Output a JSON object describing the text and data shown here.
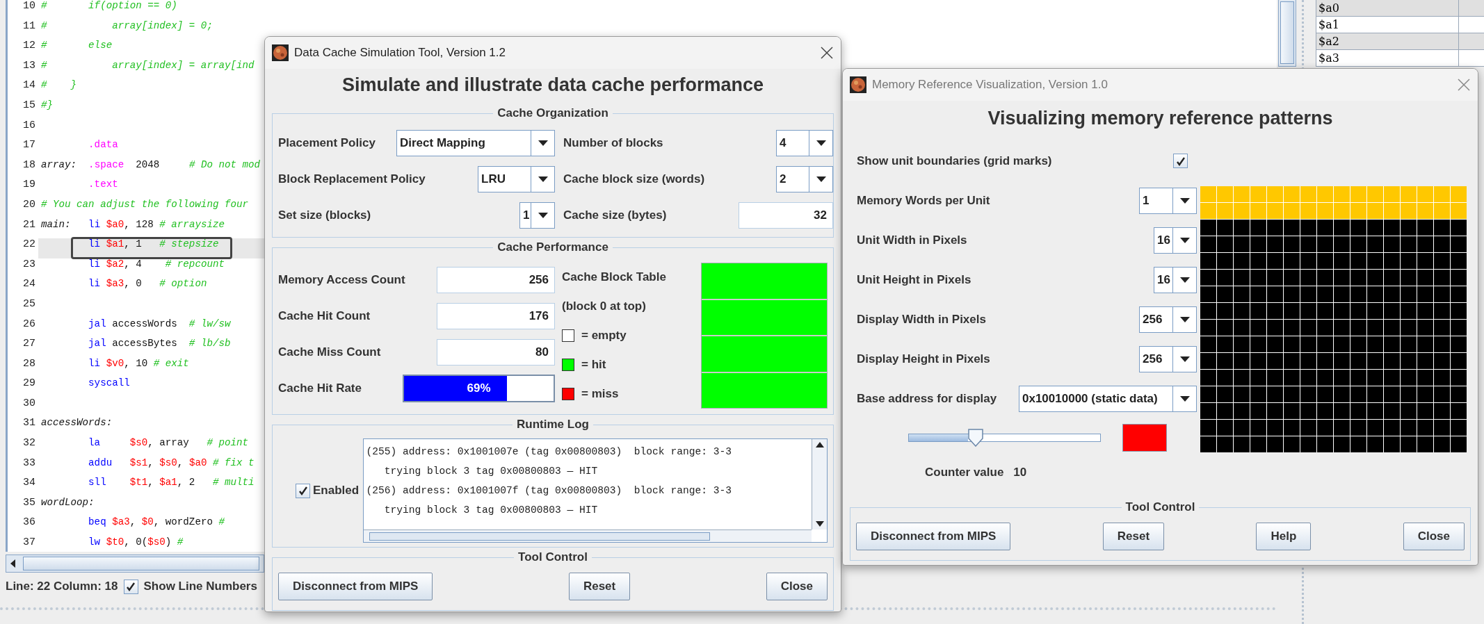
{
  "editor": {
    "lines": [
      {
        "number": "10",
        "current": false,
        "boxed": false,
        "tokens": [
          {
            "kind": "comment",
            "text": "#       if(option == 0)"
          }
        ]
      },
      {
        "number": "11",
        "current": false,
        "boxed": false,
        "tokens": [
          {
            "kind": "comment",
            "text": "#           array[index] = 0;"
          }
        ]
      },
      {
        "number": "12",
        "current": false,
        "boxed": false,
        "tokens": [
          {
            "kind": "comment",
            "text": "#       else"
          }
        ]
      },
      {
        "number": "13",
        "current": false,
        "boxed": false,
        "tokens": [
          {
            "kind": "comment",
            "text": "#           array[index] = array[ind"
          }
        ]
      },
      {
        "number": "14",
        "current": false,
        "boxed": false,
        "tokens": [
          {
            "kind": "comment",
            "text": "#    }"
          }
        ]
      },
      {
        "number": "15",
        "current": false,
        "boxed": false,
        "tokens": [
          {
            "kind": "comment",
            "text": "#}"
          }
        ]
      },
      {
        "number": "16",
        "current": false,
        "boxed": false
      },
      {
        "number": "17",
        "current": false,
        "boxed": false,
        "tokens": [
          {
            "kind": "directive",
            "text": "        .data"
          }
        ]
      },
      {
        "number": "18",
        "current": false,
        "boxed": false,
        "tokens": [
          {
            "kind": "label",
            "text": "array:"
          },
          {
            "kind": "directive",
            "text": "  .space"
          },
          {
            "kind": "text",
            "text": "  2048     "
          },
          {
            "kind": "comment",
            "text": "# Do not mod"
          }
        ]
      },
      {
        "number": "19",
        "current": false,
        "boxed": false,
        "tokens": [
          {
            "kind": "directive",
            "text": "        .text"
          }
        ]
      },
      {
        "number": "20",
        "current": false,
        "boxed": false,
        "tokens": [
          {
            "kind": "comment",
            "text": "# You can adjust the following four"
          }
        ]
      },
      {
        "number": "21",
        "current": false,
        "boxed": false,
        "tokens": [
          {
            "kind": "label",
            "text": "main:"
          },
          {
            "kind": "op",
            "text": "   li"
          },
          {
            "kind": "reg",
            "text": " $a0"
          },
          {
            "kind": "text",
            "text": ", 128 "
          },
          {
            "kind": "comment",
            "text": "# arraysize"
          }
        ]
      },
      {
        "number": "22",
        "current": true,
        "boxed": true,
        "tokens": [
          {
            "kind": "op",
            "text": "        li"
          },
          {
            "kind": "reg",
            "text": " $a1"
          },
          {
            "kind": "text",
            "text": ", 1   "
          },
          {
            "kind": "comment",
            "text": "# stepsize"
          }
        ]
      },
      {
        "number": "23",
        "current": false,
        "boxed": false,
        "tokens": [
          {
            "kind": "op",
            "text": "        li"
          },
          {
            "kind": "reg",
            "text": " $a2"
          },
          {
            "kind": "text",
            "text": ", 4    "
          },
          {
            "kind": "comment",
            "text": "# repcount"
          }
        ]
      },
      {
        "number": "24",
        "current": false,
        "boxed": false,
        "tokens": [
          {
            "kind": "op",
            "text": "        li"
          },
          {
            "kind": "reg",
            "text": " $a3"
          },
          {
            "kind": "text",
            "text": ", 0   "
          },
          {
            "kind": "comment",
            "text": "# option"
          }
        ]
      },
      {
        "number": "25",
        "current": false,
        "boxed": false
      },
      {
        "number": "26",
        "current": false,
        "boxed": false,
        "tokens": [
          {
            "kind": "op",
            "text": "        jal"
          },
          {
            "kind": "text",
            "text": " accessWords  "
          },
          {
            "kind": "comment",
            "text": "# lw/sw"
          }
        ]
      },
      {
        "number": "27",
        "current": false,
        "boxed": false,
        "tokens": [
          {
            "kind": "op",
            "text": "        jal"
          },
          {
            "kind": "text",
            "text": " accessBytes  "
          },
          {
            "kind": "comment",
            "text": "# lb/sb"
          }
        ]
      },
      {
        "number": "28",
        "current": false,
        "boxed": false,
        "tokens": [
          {
            "kind": "op",
            "text": "        li"
          },
          {
            "kind": "reg",
            "text": " $v0"
          },
          {
            "kind": "text",
            "text": ", 10 "
          },
          {
            "kind": "comment",
            "text": "# exit"
          }
        ]
      },
      {
        "number": "29",
        "current": false,
        "boxed": false,
        "tokens": [
          {
            "kind": "op",
            "text": "        syscall"
          }
        ]
      },
      {
        "number": "30",
        "current": false,
        "boxed": false
      },
      {
        "number": "31",
        "current": false,
        "boxed": false,
        "tokens": [
          {
            "kind": "label",
            "text": "accessWords:"
          }
        ]
      },
      {
        "number": "32",
        "current": false,
        "boxed": false,
        "tokens": [
          {
            "kind": "op",
            "text": "        la"
          },
          {
            "kind": "reg",
            "text": "     $s0"
          },
          {
            "kind": "text",
            "text": ", array   "
          },
          {
            "kind": "comment",
            "text": "# point"
          }
        ]
      },
      {
        "number": "33",
        "current": false,
        "boxed": false,
        "tokens": [
          {
            "kind": "op",
            "text": "        addu"
          },
          {
            "kind": "reg",
            "text": "   $s1"
          },
          {
            "kind": "text",
            "text": ", "
          },
          {
            "kind": "reg",
            "text": "$s0"
          },
          {
            "kind": "text",
            "text": ", "
          },
          {
            "kind": "reg",
            "text": "$a0"
          },
          {
            "kind": "comment",
            "text": " # fix t"
          }
        ]
      },
      {
        "number": "34",
        "current": false,
        "boxed": false,
        "tokens": [
          {
            "kind": "op",
            "text": "        sll"
          },
          {
            "kind": "reg",
            "text": "    $t1"
          },
          {
            "kind": "text",
            "text": ", "
          },
          {
            "kind": "reg",
            "text": "$a1"
          },
          {
            "kind": "text",
            "text": ", 2   "
          },
          {
            "kind": "comment",
            "text": "# multi"
          }
        ]
      },
      {
        "number": "35",
        "current": false,
        "boxed": false,
        "tokens": [
          {
            "kind": "label",
            "text": "wordLoop:"
          }
        ]
      },
      {
        "number": "36",
        "current": false,
        "boxed": false,
        "tokens": [
          {
            "kind": "op",
            "text": "        beq"
          },
          {
            "kind": "reg",
            "text": " $a3"
          },
          {
            "kind": "text",
            "text": ", "
          },
          {
            "kind": "reg",
            "text": "$0"
          },
          {
            "kind": "text",
            "text": ", wordZero "
          },
          {
            "kind": "comment",
            "text": "#"
          }
        ]
      },
      {
        "number": "37",
        "current": false,
        "boxed": false,
        "tokens": [
          {
            "kind": "op",
            "text": "        lw"
          },
          {
            "kind": "reg",
            "text": " $t0"
          },
          {
            "kind": "text",
            "text": ", 0("
          },
          {
            "kind": "reg",
            "text": "$s0"
          },
          {
            "kind": "text",
            "text": ") "
          },
          {
            "kind": "comment",
            "text": "#"
          }
        ]
      }
    ],
    "status": {
      "position": "Line: 22 Column: 18",
      "show_line_numbers": {
        "label": "Show Line Numbers",
        "checked": true
      }
    }
  },
  "registers": [
    "$a0",
    "$a1",
    "$a2",
    "$a3"
  ],
  "cache_tool": {
    "title": "Data Cache Simulation Tool, Version 1.2",
    "active": true,
    "heading": "Simulate and illustrate data cache performance",
    "organization": {
      "title": "Cache Organization",
      "settings": [
        {
          "label": "Placement Policy",
          "kind": "dropdown",
          "value": "Direct Mapping"
        },
        {
          "label": "Number of blocks",
          "kind": "dropdown",
          "value": "4"
        },
        {
          "label": "Block Replacement Policy",
          "kind": "dropdown",
          "value": "LRU"
        },
        {
          "label": "Cache block size (words)",
          "kind": "dropdown",
          "value": "2"
        },
        {
          "label": "Set size (blocks)",
          "kind": "dropdown",
          "value": "1"
        },
        {
          "label": "Cache size (bytes)",
          "kind": "field",
          "value": "32"
        }
      ]
    },
    "performance": {
      "title": "Cache Performance",
      "counters": [
        {
          "label": "Memory Access Count",
          "value": "256"
        },
        {
          "label": "Cache Hit Count",
          "value": "176"
        },
        {
          "label": "Cache Miss Count",
          "value": "80"
        }
      ],
      "hit_rate": {
        "label": "Cache Hit Rate",
        "level": 0.69,
        "reading": "69%"
      },
      "block_table": {
        "title": "Cache Block Table",
        "subtitle": "(block 0 at top)",
        "legend": [
          {
            "label": "= empty",
            "color": "#ffffff"
          },
          {
            "label": "= hit",
            "color": "#00ff00"
          },
          {
            "label": "= miss",
            "color": "#ff0000"
          }
        ],
        "blocks": [
          {
            "color": "#00ff00"
          },
          {
            "color": "#00ff00"
          },
          {
            "color": "#00ff00"
          },
          {
            "color": "#00ff00"
          }
        ]
      }
    },
    "log": {
      "title": "Runtime Log",
      "enabled": {
        "label": "Enabled",
        "checked": true
      },
      "lines": [
        "(255) address: 0x1001007e (tag 0x00800803)  block range: 3-3",
        "   trying block 3 tag 0x00800803 — HIT",
        "(256) address: 0x1001007f (tag 0x00800803)  block range: 3-3",
        "   trying block 3 tag 0x00800803 — HIT"
      ]
    },
    "control": {
      "title": "Tool Control",
      "buttons": [
        "Disconnect from MIPS",
        "Reset",
        "Close"
      ]
    }
  },
  "memory_tool": {
    "title": "Memory Reference Visualization, Version 1.0",
    "active": false,
    "heading": "Visualizing memory reference patterns",
    "settings": [
      {
        "label": "Show unit boundaries (grid marks)",
        "kind": "checkbox",
        "checked": true
      },
      {
        "label": "Memory Words per Unit",
        "kind": "dropdown",
        "value": "1"
      },
      {
        "label": "Unit Width in Pixels",
        "kind": "dropdown",
        "value": "16"
      },
      {
        "label": "Unit Height in Pixels",
        "kind": "dropdown",
        "value": "16"
      },
      {
        "label": "Display Width in Pixels",
        "kind": "dropdown",
        "value": "256"
      },
      {
        "label": "Display Height in Pixels",
        "kind": "dropdown",
        "value": "256"
      },
      {
        "label": "Base address for display",
        "kind": "dropdown",
        "value": "0x10010000 (static data)"
      }
    ],
    "slider": {
      "level": 0.35
    },
    "counter": {
      "label": "Counter value",
      "value": "10",
      "color": "#ff0000"
    },
    "grid_rows": [
      {
        "color": "#ffc800"
      },
      {
        "color": "#ffc800"
      },
      {
        "color": "#000000"
      },
      {
        "color": "#000000"
      },
      {
        "color": "#000000"
      },
      {
        "color": "#000000"
      },
      {
        "color": "#000000"
      },
      {
        "color": "#000000"
      },
      {
        "color": "#000000"
      },
      {
        "color": "#000000"
      },
      {
        "color": "#000000"
      },
      {
        "color": "#000000"
      },
      {
        "color": "#000000"
      },
      {
        "color": "#000000"
      },
      {
        "color": "#000000"
      },
      {
        "color": "#000000"
      }
    ],
    "control": {
      "title": "Tool Control",
      "buttons": [
        "Disconnect from MIPS",
        "Reset",
        "Help",
        "Close"
      ]
    }
  }
}
